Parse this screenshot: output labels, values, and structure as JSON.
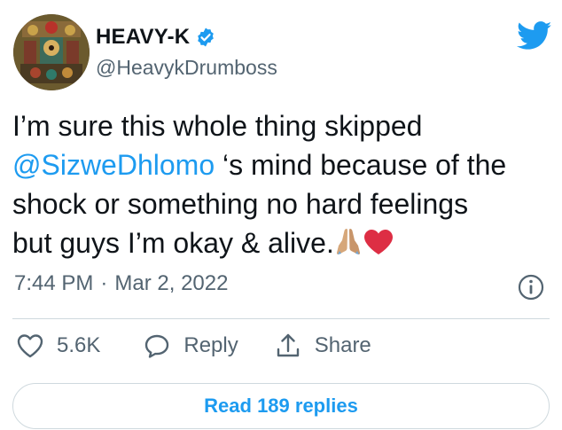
{
  "user": {
    "display_name": "HEAVY-K",
    "handle": "@HeavykDrumboss",
    "verified": true
  },
  "tweet": {
    "line1": "I’m sure this whole thing skipped",
    "mention": "@SizweDhlomo",
    "line2_rest": " ‘s mind because of the",
    "line3": "shock or something no hard feelings",
    "line4": "but guys I’m okay & alive.",
    "emojis": [
      "folded-hands-icon",
      "red-heart-icon"
    ]
  },
  "meta": {
    "time": "7:44 PM",
    "separator": "·",
    "date": "Mar 2, 2022"
  },
  "actions": {
    "like_count": "5.6K",
    "reply_label": "Reply",
    "share_label": "Share"
  },
  "read_replies_label": "Read 189 replies",
  "colors": {
    "accent": "#1d9bf0",
    "text": "#0f1419",
    "secondary": "#536471",
    "border": "#cfd9de"
  }
}
